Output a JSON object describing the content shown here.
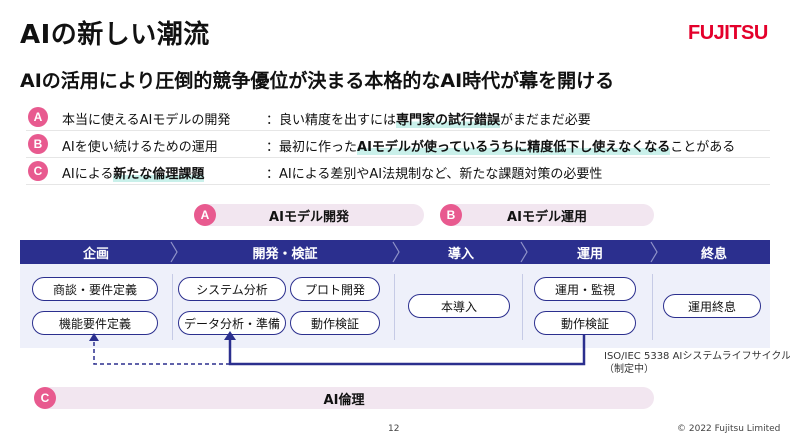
{
  "slide": {
    "title": "AIの新しい潮流",
    "logo": "FUJITSU",
    "subtitle": "AIの活用により圧倒的競争優位が決まる本格的なAI時代が幕を開ける"
  },
  "issues": [
    {
      "badge": "A",
      "label": "本当に使えるAIモデルの開発",
      "text_pre": "：良い精度を出すには",
      "text_hl": "専門家の試行錯誤",
      "text_post": "がまだまだ必要"
    },
    {
      "badge": "B",
      "label": "AIを使い続けるための運用",
      "text_pre": "：最初に作った",
      "text_hl": "AIモデルが使っているうちに精度低下し使えなくなる",
      "text_post": "ことがある"
    },
    {
      "badge": "C",
      "label_pre": "AIによる",
      "label_hl": "新たな倫理課題",
      "text_pre": "：AIによる差別やAI法規制など、新たな課題対策の必要性",
      "text_hl": "",
      "text_post": ""
    }
  ],
  "pills": {
    "a": {
      "badge": "A",
      "label": "AIモデル開発"
    },
    "b": {
      "badge": "B",
      "label": "AIモデル運用"
    },
    "c": {
      "badge": "C",
      "label": "AI倫理"
    }
  },
  "phases": [
    "企画",
    "開発・検証",
    "導入",
    "運用",
    "終息"
  ],
  "boxes": {
    "plan1": "商談・要件定義",
    "plan2": "機能要件定義",
    "dev1": "システム分析",
    "dev2": "プロト開発",
    "dev3": "データ分析・準備",
    "dev4": "動作検証",
    "intro1": "本導入",
    "ops1": "運用・監視",
    "ops2": "動作検証",
    "end1": "運用終息"
  },
  "standard": {
    "line1": "ISO/IEC 5338 AIシステムライフサイクル",
    "line2": "（制定中）"
  },
  "footer": {
    "page": "12",
    "copyright": "© 2022 Fujitsu Limited"
  },
  "colors": {
    "navy": "#2b2f8e",
    "badge_pink": "#e85a8f",
    "pill_bg": "#f2e6f0",
    "logo_red": "#e4002b",
    "highlight": "#c9f0ea"
  }
}
